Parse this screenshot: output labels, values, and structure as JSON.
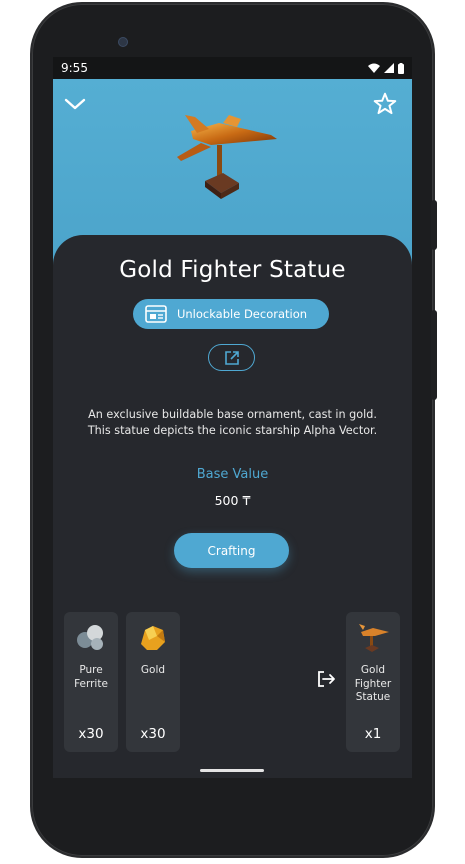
{
  "status_bar": {
    "time": "9:55"
  },
  "header": {
    "back_icon": "chevron-down-icon",
    "favorite_icon": "star-outline-icon"
  },
  "item": {
    "title": "Gold Fighter Statue",
    "category_label": "Unlockable Decoration",
    "description_line1": "An exclusive buildable base ornament, cast in gold.",
    "description_line2": "This statue depicts the iconic starship Alpha Vector.",
    "base_value_label": "Base Value",
    "base_value": "500",
    "currency_symbol": "₸"
  },
  "actions": {
    "crafting_label": "Crafting"
  },
  "recipe": {
    "ingredients": [
      {
        "name_line1": "Pure",
        "name_line2": "Ferrite",
        "qty": "x30"
      },
      {
        "name_line1": "Gold",
        "qty": "x30"
      }
    ],
    "output": {
      "name_line1": "Gold",
      "name_line2": "Fighter",
      "name_line3": "Statue",
      "qty": "x1"
    }
  },
  "colors": {
    "accent": "#4fa8d2",
    "hero_bg": "#55aed3",
    "card_bg": "#26282d",
    "tile_bg": "#33363b"
  }
}
